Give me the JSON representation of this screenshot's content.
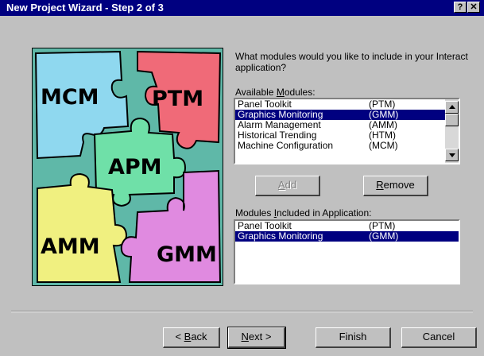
{
  "window": {
    "title": "New Project Wizard - Step 2 of 3",
    "help_glyph": "?",
    "close_glyph": "✕"
  },
  "art": {
    "pieces": {
      "mcm": "MCM",
      "ptm": "PTM",
      "apm": "APM",
      "amm": "AMM",
      "gmm": "GMM"
    }
  },
  "prompt": "What modules would you like to include in your Interact application?",
  "available": {
    "label_pre": "Available ",
    "label_key": "M",
    "label_post": "odules:",
    "rows": [
      {
        "name": "Panel Toolkit",
        "code": "(PTM)"
      },
      {
        "name": "Graphics Monitoring",
        "code": "(GMM)"
      },
      {
        "name": "Alarm Management",
        "code": "(AMM)"
      },
      {
        "name": "Historical Trending",
        "code": "(HTM)"
      },
      {
        "name": "Machine Configuration",
        "code": "(MCM)"
      }
    ]
  },
  "buttons": {
    "add_key": "A",
    "add_rest": "dd",
    "remove_key": "R",
    "remove_rest": "emove",
    "back_pre": "< ",
    "back_key": "B",
    "back_rest": "ack",
    "next_key": "N",
    "next_rest": "ext >",
    "finish": "Finish",
    "cancel": "Cancel"
  },
  "included": {
    "label_pre": "Modules ",
    "label_key": "I",
    "label_post": "ncluded in Application:",
    "rows": [
      {
        "name": "Panel Toolkit",
        "code": "(PTM)"
      },
      {
        "name": "Graphics Monitoring",
        "code": "(GMM)"
      }
    ]
  },
  "colors": {
    "titlebar": "#000080",
    "selection": "#000080",
    "face": "#c0c0c0",
    "art_background": "#5fb8a8",
    "piece_mcm": "#8fd8ef",
    "piece_ptm": "#f06a78",
    "piece_apm": "#6fe0a8",
    "piece_amm": "#f0f080",
    "piece_gmm": "#e08ae0"
  }
}
